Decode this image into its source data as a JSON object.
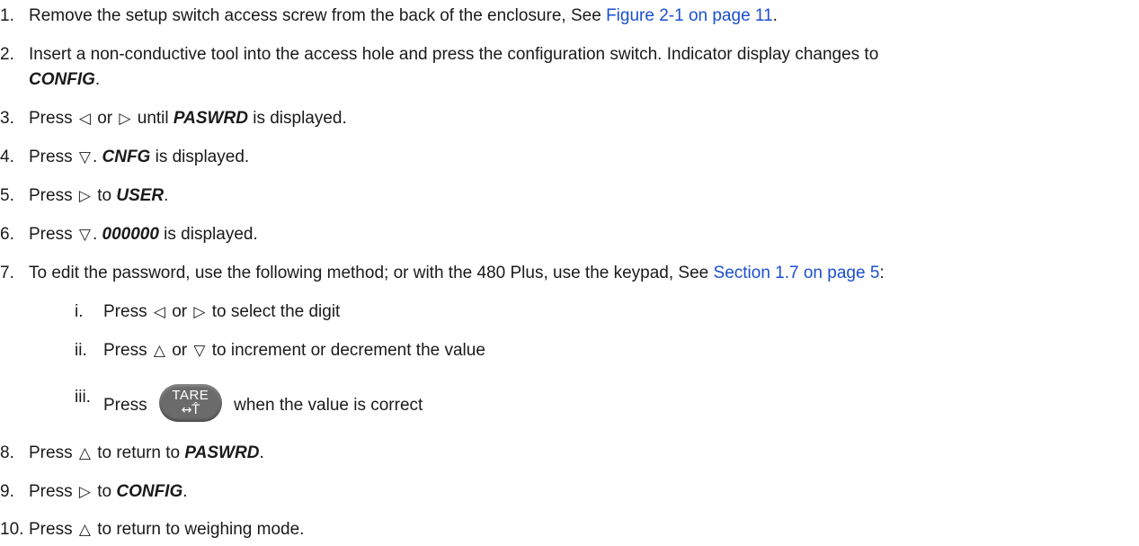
{
  "steps": [
    {
      "num": "1.",
      "text_a": "Remove the setup switch access screw from the back of the enclosure, See ",
      "link": "Figure 2-1 on page 11",
      "text_b": "."
    },
    {
      "num": "2.",
      "text_a": "Insert a non-conductive tool into the access hole and press the configuration switch. Indicator display changes to",
      "kw": "CONFIG",
      "text_b": "."
    },
    {
      "num": "3.",
      "pre": "Press ",
      "mid": " or ",
      "post": "  until ",
      "kw": "PASWRD",
      "end": " is displayed."
    },
    {
      "num": "4.",
      "pre": "Press ",
      "dot": ". ",
      "kw": "CNFG",
      "end": " is displayed."
    },
    {
      "num": "5.",
      "pre": "Press ",
      "mid": " to ",
      "kw": "USER",
      "end": "."
    },
    {
      "num": "6.",
      "pre": "Press ",
      "dot": ". ",
      "kw": "000000",
      "end": " is displayed."
    },
    {
      "num": "7.",
      "text_a": "To edit the password, use the following method; or with the 480 Plus, use the keypad, See ",
      "link": "Section 1.7 on page 5",
      "text_b": ":"
    },
    {
      "num": "8.",
      "pre": "Press ",
      "mid": " to return to ",
      "kw": "PASWRD",
      "end": "."
    },
    {
      "num": "9.",
      "pre": "Press ",
      "mid": " to ",
      "kw": "CONFIG",
      "end": "."
    },
    {
      "num": "10.",
      "pre": "Press ",
      "end": " to return to weighing mode."
    }
  ],
  "substeps": [
    {
      "rn": "i.",
      "pre": "Press ",
      "mid": " or ",
      "end": " to select the digit"
    },
    {
      "rn": "ii.",
      "pre": "Press ",
      "mid": " or ",
      "end": " to increment or decrement the value"
    },
    {
      "rn": "iii.",
      "pre": "Press ",
      "end": " when the value is correct"
    }
  ],
  "tare_button": {
    "label": "TARE",
    "icon": "↔T̂"
  },
  "icons": {
    "left": "◁",
    "right": "▷",
    "up": "△",
    "down": "▽"
  },
  "colors": {
    "link": "#1a4fd0",
    "text": "#1a1a1a",
    "tare_button": "#6b6b6b"
  }
}
